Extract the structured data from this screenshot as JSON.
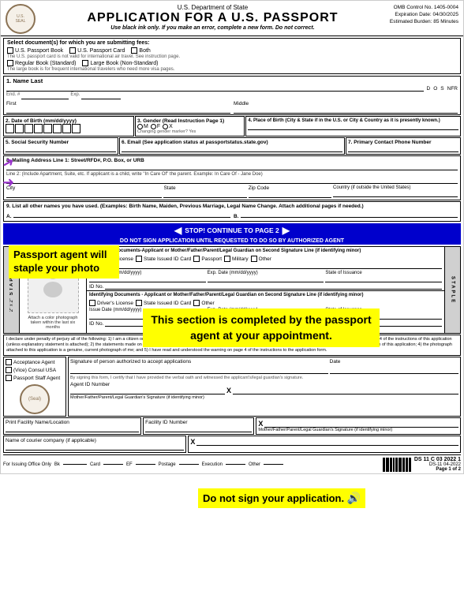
{
  "header": {
    "dept": "U.S. Department of State",
    "title": "APPLICATION FOR A U.S. PASSPORT",
    "ink_note": "Use black ink only. If you make an error, complete a new form. Do not correct.",
    "omb_control": "OMB Control No. 1405-0004",
    "expiration": "Expiration Date: 04/30/2025",
    "burden": "Estimated Burden: 85 Minutes"
  },
  "doc_select": {
    "label": "Select document(s) for which you are submitting fees:",
    "options": [
      "U.S. Passport Book",
      "U.S. Passport Card",
      "Both"
    ],
    "note1": "The U.S. passport card is not valid for international air travel. See instruction page.",
    "sub_options": [
      "Regular Book (Standard)",
      "Large Book (Non-Standard)"
    ],
    "note2": "The large book is for frequent international travelers who need more visa pages."
  },
  "fields": {
    "name_label": "1. Name Last",
    "d_label": "D",
    "o_label": "O",
    "s_label": "S",
    "nfr_label": "NFR",
    "end_label": "End. #",
    "exp_label": "Exp.",
    "first_label": "First",
    "middle_label": "Middle",
    "dob_label": "2. Date of Birth (mm/dd/yyyy)",
    "gender_label": "3. Gender (Read Instruction Page 1)",
    "gender_m": "M",
    "gender_f": "F",
    "gender_x": "X",
    "changing_note": "Changing gender marker? Yes",
    "place_birth_label": "4. Place of Birth (City & State if in the U.S. or City & Country as it is presently known.)",
    "ssn_label": "5. Social Security Number",
    "email_label": "6. Email (See application status at passportstatus.state.gov)",
    "phone_label": "7. Primary Contact Phone Number",
    "mailing_label": "8. Mailing Address Line 1: Street/RFD#, P.O. Box, or URB",
    "mailing_line2": "Line 2: (Include Apartment, Suite, etc. If applicant is a child, write \"In Care Of\" the parent. Example: In Care Of - Jane Doe)",
    "city_label": "City",
    "state_label": "State",
    "zip_label": "Zip Code",
    "country_label": "Country (if outside the United States)",
    "other_names_label": "9. List all other names you have used. (Examples: Birth Name, Maiden, Previous Marriage, Legal Name Change. Attach additional pages if needed.)",
    "other_names_a": "A.",
    "other_names_b": "B."
  },
  "stop_banner": {
    "text": "STOP! CONTINUE TO PAGE 2",
    "subtext": "DO NOT SIGN APPLICATION UNTIL REQUESTED TO DO SO BY AUTHORIZED AGENT"
  },
  "staple_section": {
    "staple_label": "STAPLE",
    "size_label": "2\" x 2\"",
    "photo_caption": "Attach a color photograph taken within the last six months",
    "photo_instructions": "Attach a color photograph taken within the last six months"
  },
  "id_section": {
    "title1": "Identifying Documents-Applicant or Mother/Father/Parent/Legal Guardian on Second Signature Line (if identifying minor)",
    "drivers": "Driver's License",
    "state_id": "State Issued ID Card",
    "passport": "Passport",
    "military": "Military",
    "other": "Other",
    "name_label": "Name",
    "issue_date": "Issue Date (mm/dd/yyyy)",
    "exp_date": "Exp. Date (mm/dd/yyyy)",
    "state_issuance": "State of Issuance",
    "id_no": "ID No.",
    "title2": "Identifying Documents - Applicant or Mother/Father/Parent/Legal Guardian on Second Signature Line (if identifying minor)",
    "title2_short": "Identifying Documents – Appl..."
  },
  "overlays": {
    "passport_agent": "Passport agent will staple your photo",
    "section_completed": "This section is completed by the passport agent at your appointment.",
    "do_not_sign": "Do not sign your application."
  },
  "declaration": {
    "text": "I declare under penalty of perjury all of the following: 1) I am a citizen or non-citizen national of the United States and have not performed any of the acts listed under \"Acts or Conditions\" on page 4 of the instructions of this application (unless explanatory statement is attached); 2) the statements made on the application are true and correct; 3) I have not knowingly and willfully made false statements or included false information of this application; 4) the photograph attached to this application is a genuine, current photograph of me; and 5) I have read and understood the warning on page 4 of the instructions to the application form."
  },
  "bottom": {
    "acceptance_agent": "Acceptance Agent",
    "consulate": "(Vice) Consul USA",
    "passport_staff": "Passport Staff Agent",
    "seal_label": "(Seal)",
    "sig_authorized": "Signature of person authorized to accept applications",
    "date_label": "Date",
    "agent_id": "Agent ID Number",
    "verbal_oath": "By signing this form, I certify that I have provided the verbal oath and witnessed the applicant's/legal guardian's signature.",
    "print_facility": "Print Facility Name/Location",
    "facility_id": "Facility ID Number",
    "courier": "Name of courier company (if applicable)",
    "x_mark1": "X",
    "x_mark2": "X",
    "x_mark3": "X",
    "mother_sig": "Mother/Father/Parent/Legal Guardian's Signature (if identifying minor)",
    "guardian_sig": "Mother/Father/Parent/Legal Guardian's Signature (if identifying minor)",
    "issuing": "For Issuing Office Only",
    "bk": "Bk",
    "card": "Card",
    "ef": "EF",
    "postage": "Postage",
    "execution": "Execution",
    "other": "Other",
    "ds_form": "DS-11 04-2022",
    "ds_number": "DS 11 C 03 2022 1",
    "page": "Page 1 of 2"
  }
}
